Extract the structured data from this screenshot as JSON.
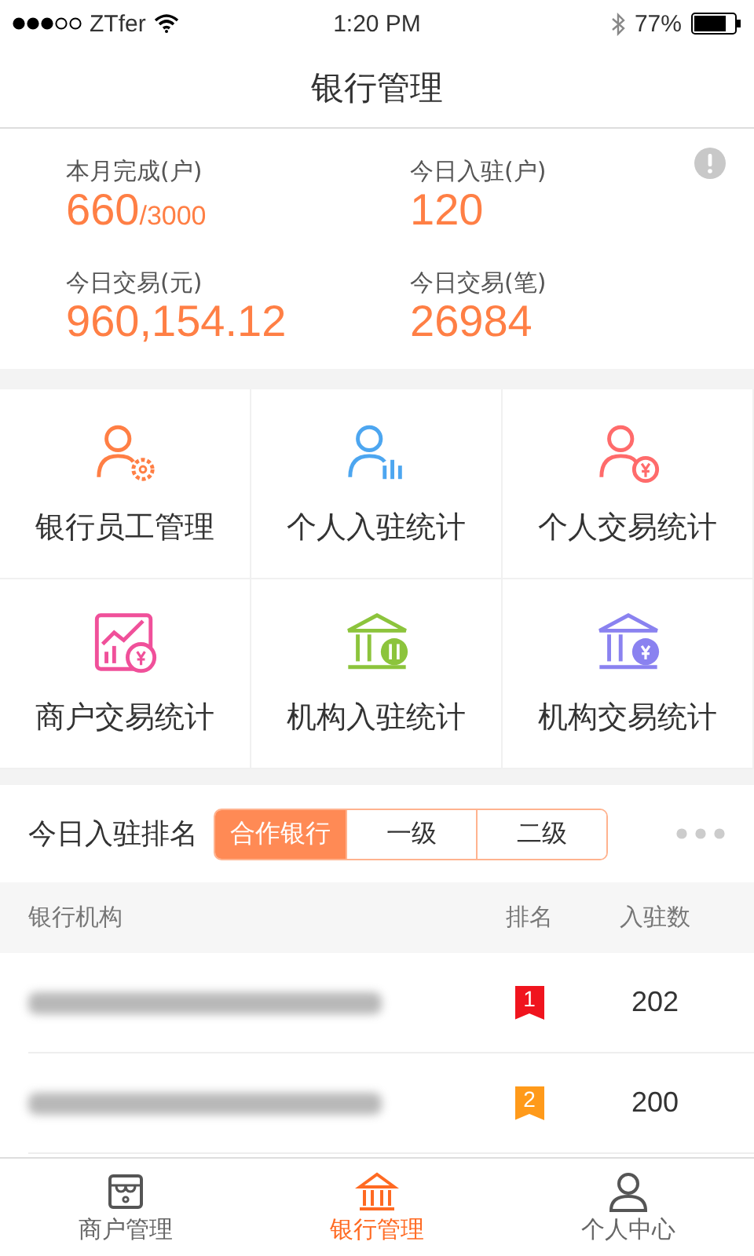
{
  "status_bar": {
    "carrier": "ZTfer",
    "time": "1:20 PM",
    "battery": "77%"
  },
  "nav": {
    "title": "银行管理"
  },
  "stats": [
    {
      "label": "本月完成(户)",
      "value": "660",
      "suffix": "/3000"
    },
    {
      "label": "今日入驻(户)",
      "value": "120"
    },
    {
      "label": "今日交易(元)",
      "value": "960,154.12"
    },
    {
      "label": "今日交易(笔)",
      "value": "26984"
    }
  ],
  "menu": [
    {
      "kind": "staff",
      "color": "#ff7f45",
      "label": "银行员工管理"
    },
    {
      "kind": "person-chart",
      "color": "#4da6f0",
      "label": "个人入驻统计"
    },
    {
      "kind": "person-money",
      "color": "#ff6b6b",
      "label": "个人交易统计"
    },
    {
      "kind": "merchant-chart",
      "color": "#f0509a",
      "label": "商户交易统计"
    },
    {
      "kind": "bank-chart",
      "color": "#8cc43c",
      "label": "机构入驻统计"
    },
    {
      "kind": "bank-money",
      "color": "#8a82f0",
      "label": "机构交易统计"
    }
  ],
  "ranking": {
    "title": "今日入驻排名",
    "segments": [
      {
        "label": "合作银行",
        "selected": true
      },
      {
        "label": "一级",
        "selected": false
      },
      {
        "label": "二级",
        "selected": false
      }
    ],
    "columns": [
      "银行机构",
      "排名",
      "入驻数"
    ],
    "rows": [
      {
        "rank": "1",
        "color": "#f0141e",
        "count": "202"
      },
      {
        "rank": "2",
        "color": "#ff9a1a",
        "count": "200"
      }
    ]
  },
  "tab_bar": [
    {
      "kind": "store",
      "label": "商户管理",
      "selected": false
    },
    {
      "kind": "bank",
      "label": "银行管理",
      "selected": true
    },
    {
      "kind": "person",
      "label": "个人中心",
      "selected": false
    }
  ]
}
